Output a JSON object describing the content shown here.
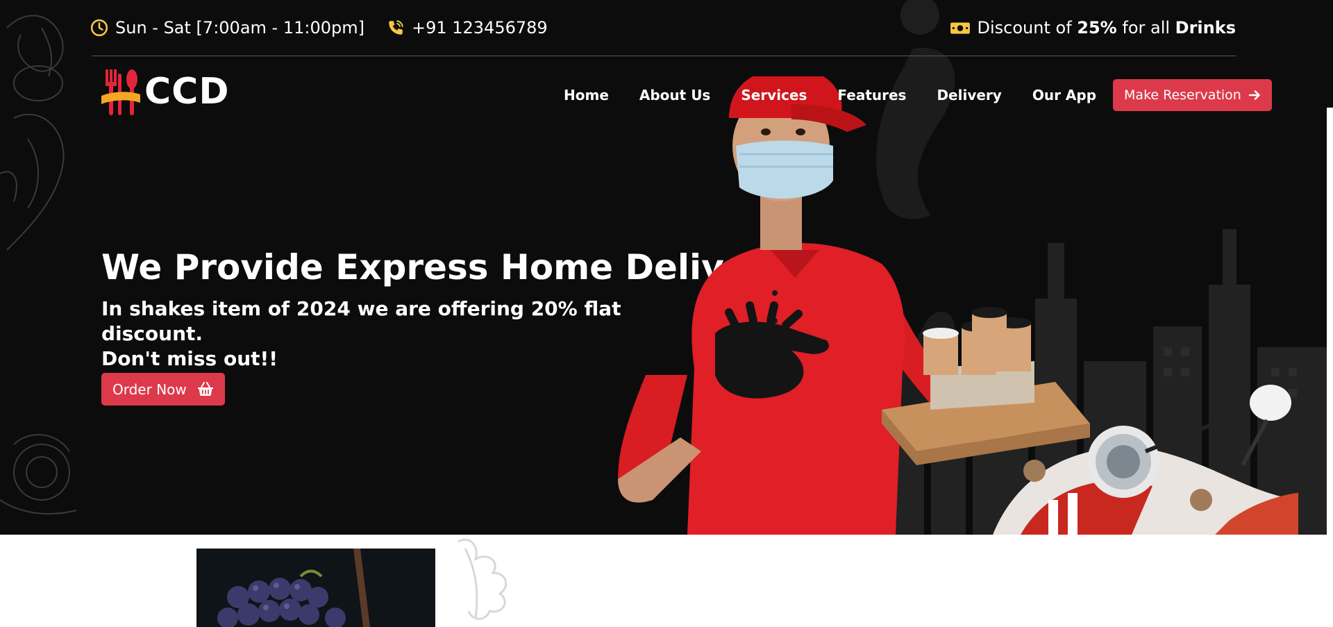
{
  "topbar": {
    "hours": "Sun - Sat [7:00am - 11:00pm]",
    "phone": "+91 123456789",
    "discount_prefix": "Discount of ",
    "discount_amount": "25%",
    "discount_middle": " for all ",
    "discount_item": "Drinks"
  },
  "brand": {
    "name": "CCD"
  },
  "nav": {
    "items": [
      {
        "label": "Home"
      },
      {
        "label": "About Us"
      },
      {
        "label": "Services"
      },
      {
        "label": "Features"
      },
      {
        "label": "Delivery"
      },
      {
        "label": "Our App"
      }
    ],
    "cta_label": "Make Reservation"
  },
  "hero": {
    "headline": "We Provide Express Home Delivery",
    "subline_1": "In shakes item of 2024 we are offering 20% flat discount.",
    "subline_2": "Don't miss out!!",
    "order_label": "Order Now"
  },
  "colors": {
    "accent": "#dc3a4b",
    "icon_yellow": "#f5c842",
    "hero_bg": "#0c0c0c"
  },
  "icons": [
    "clock-icon",
    "phone-icon",
    "cash-icon",
    "arrow-right-icon",
    "basket-icon"
  ]
}
